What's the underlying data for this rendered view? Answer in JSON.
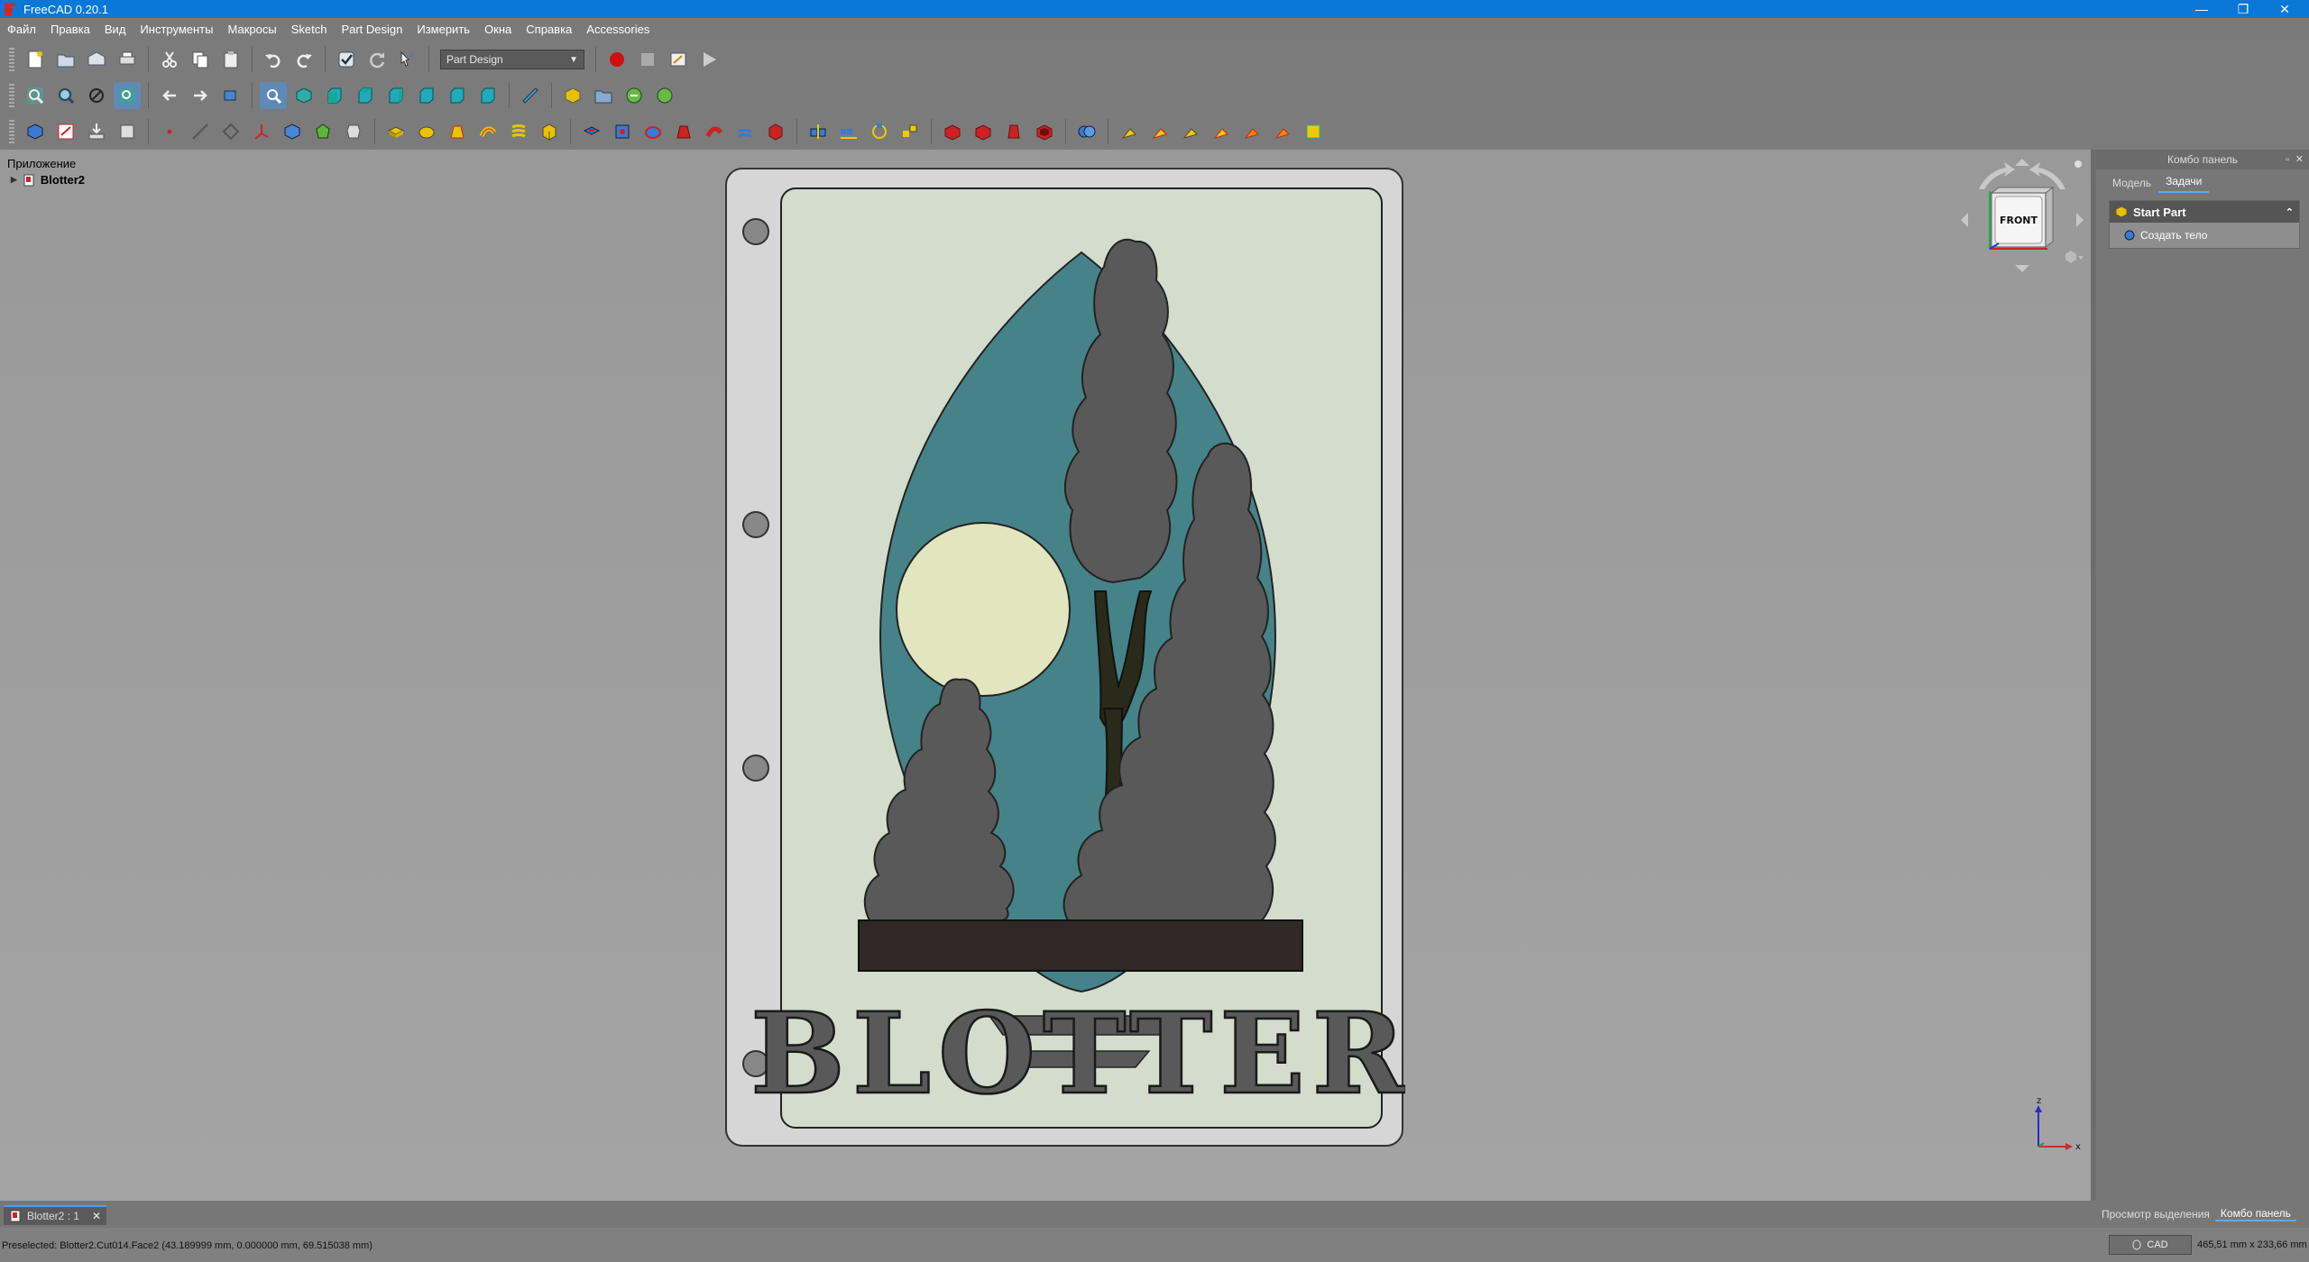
{
  "window": {
    "title": "FreeCAD 0.20.1",
    "controls": [
      "—",
      "❐",
      "✕"
    ]
  },
  "menu": [
    "Файл",
    "Правка",
    "Вид",
    "Инструменты",
    "Макросы",
    "Sketch",
    "Part Design",
    "Измерить",
    "Окна",
    "Справка",
    "Accessories"
  ],
  "toolbar": {
    "workbench": "Part Design"
  },
  "tree": {
    "header": "Приложение",
    "root": "Blotter2"
  },
  "model": {
    "text": "BLOTTER",
    "colors": {
      "frame": "#d6d6d6",
      "card": "#d4dccc",
      "sky": "#458389",
      "moon": "#e2e6bf",
      "trees": "#595959",
      "trunk": "#2a2a1a",
      "ground": "#302828"
    }
  },
  "navcube": {
    "face": "FRONT"
  },
  "axis": {
    "x": "x",
    "z": "z"
  },
  "combo": {
    "title": "Комбо панель",
    "tabs": [
      "Модель",
      "Задачи"
    ],
    "active_tab": "Задачи",
    "task_header": "Start Part",
    "task_action": "Создать тело"
  },
  "doc_tab": "Blotter2 : 1",
  "bottom_tabs": [
    "Просмотр выделения",
    "Комбо панель"
  ],
  "status": {
    "text": "Preselected: Blotter2.Cut014.Face2 (43.189999 mm, 0.000000 mm, 69.515038 mm)",
    "nav": "CAD",
    "dims": "465,51 mm x 233,66 mm"
  }
}
